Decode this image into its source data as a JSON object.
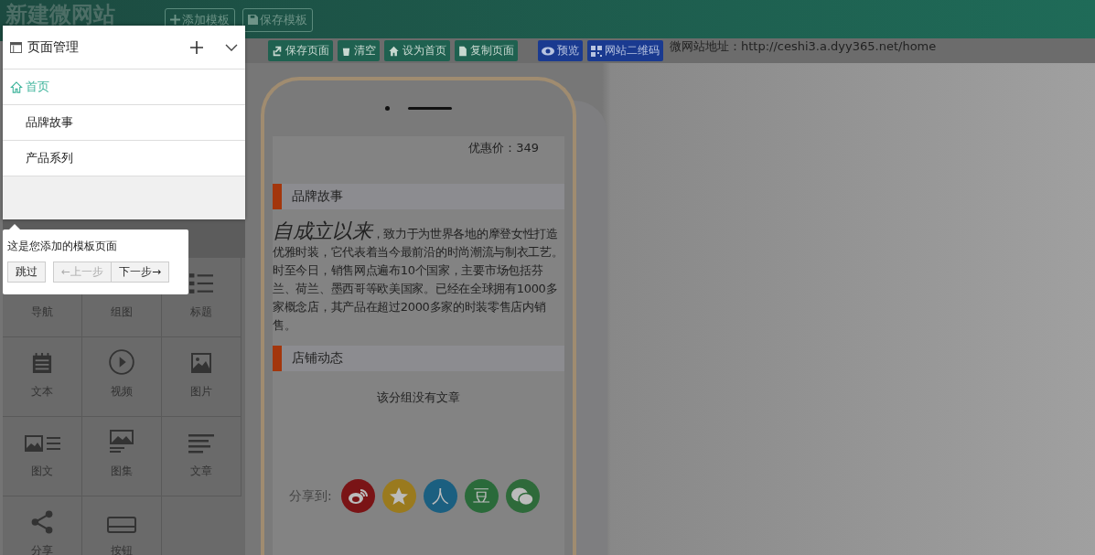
{
  "header": {
    "title": "新建微网站",
    "buttons": [
      {
        "label": "添加模板"
      },
      {
        "label": "保存模板"
      }
    ]
  },
  "toolbar": {
    "buttons": [
      {
        "label": "保存页面",
        "kind": "green"
      },
      {
        "label": "清空",
        "kind": "green"
      },
      {
        "label": "设为首页",
        "kind": "green"
      },
      {
        "label": "复制页面",
        "kind": "green"
      },
      {
        "label": "预览",
        "kind": "blue"
      },
      {
        "label": "网站二维码",
        "kind": "blue"
      }
    ],
    "site_url": "微网站地址：http://ceshi3.a.dyy365.net/home"
  },
  "widgets": [
    {
      "label": "导航"
    },
    {
      "label": "组图"
    },
    {
      "label": "标题"
    },
    {
      "label": "文本"
    },
    {
      "label": "视频"
    },
    {
      "label": "图片"
    },
    {
      "label": "图文"
    },
    {
      "label": "图集"
    },
    {
      "label": "文章"
    },
    {
      "label": "分享"
    },
    {
      "label": "按钮"
    }
  ],
  "preview": {
    "price": "优惠价：349",
    "sections": [
      {
        "title": "品牌故事",
        "kind": "article",
        "body": "*自成立以来*，致力于为世界各地的摩登女性打造优雅时装，它代表着当今最前沿的时尚潮流与制衣工艺。时至今日，销售网点遍布10个国家，主要市场包括芬兰、荷兰、墨西哥等欧美国家。已经在全球拥有1000多家概念店，其产品在超过2000多家的时装零售店内销售。"
      },
      {
        "title": "店铺动态",
        "kind": "empty",
        "body": "该分组没有文章"
      }
    ],
    "share": {
      "label": "分享到:",
      "targets": [
        {
          "kind": "weibo",
          "color": "#7a1416"
        },
        {
          "kind": "qzone",
          "color": "#9a7a1e"
        },
        {
          "kind": "glyph",
          "glyph": "人",
          "color": "#1b5f80"
        },
        {
          "kind": "glyph",
          "glyph": "豆",
          "color": "#2a6a3a"
        },
        {
          "kind": "wechat",
          "color": "#2e6a3a"
        }
      ]
    }
  },
  "page_manager": {
    "title": "页面管理",
    "pages": [
      {
        "label": "首页",
        "selected": true
      },
      {
        "label": "品牌故事",
        "selected": false
      },
      {
        "label": "产品系列",
        "selected": false
      }
    ]
  },
  "guide": {
    "message": "这是您添加的模板页面",
    "buttons": [
      {
        "label": "跳过",
        "disabled": false
      },
      {
        "label": "←上一步",
        "disabled": true
      },
      {
        "label": "下一步→",
        "disabled": false
      }
    ]
  }
}
